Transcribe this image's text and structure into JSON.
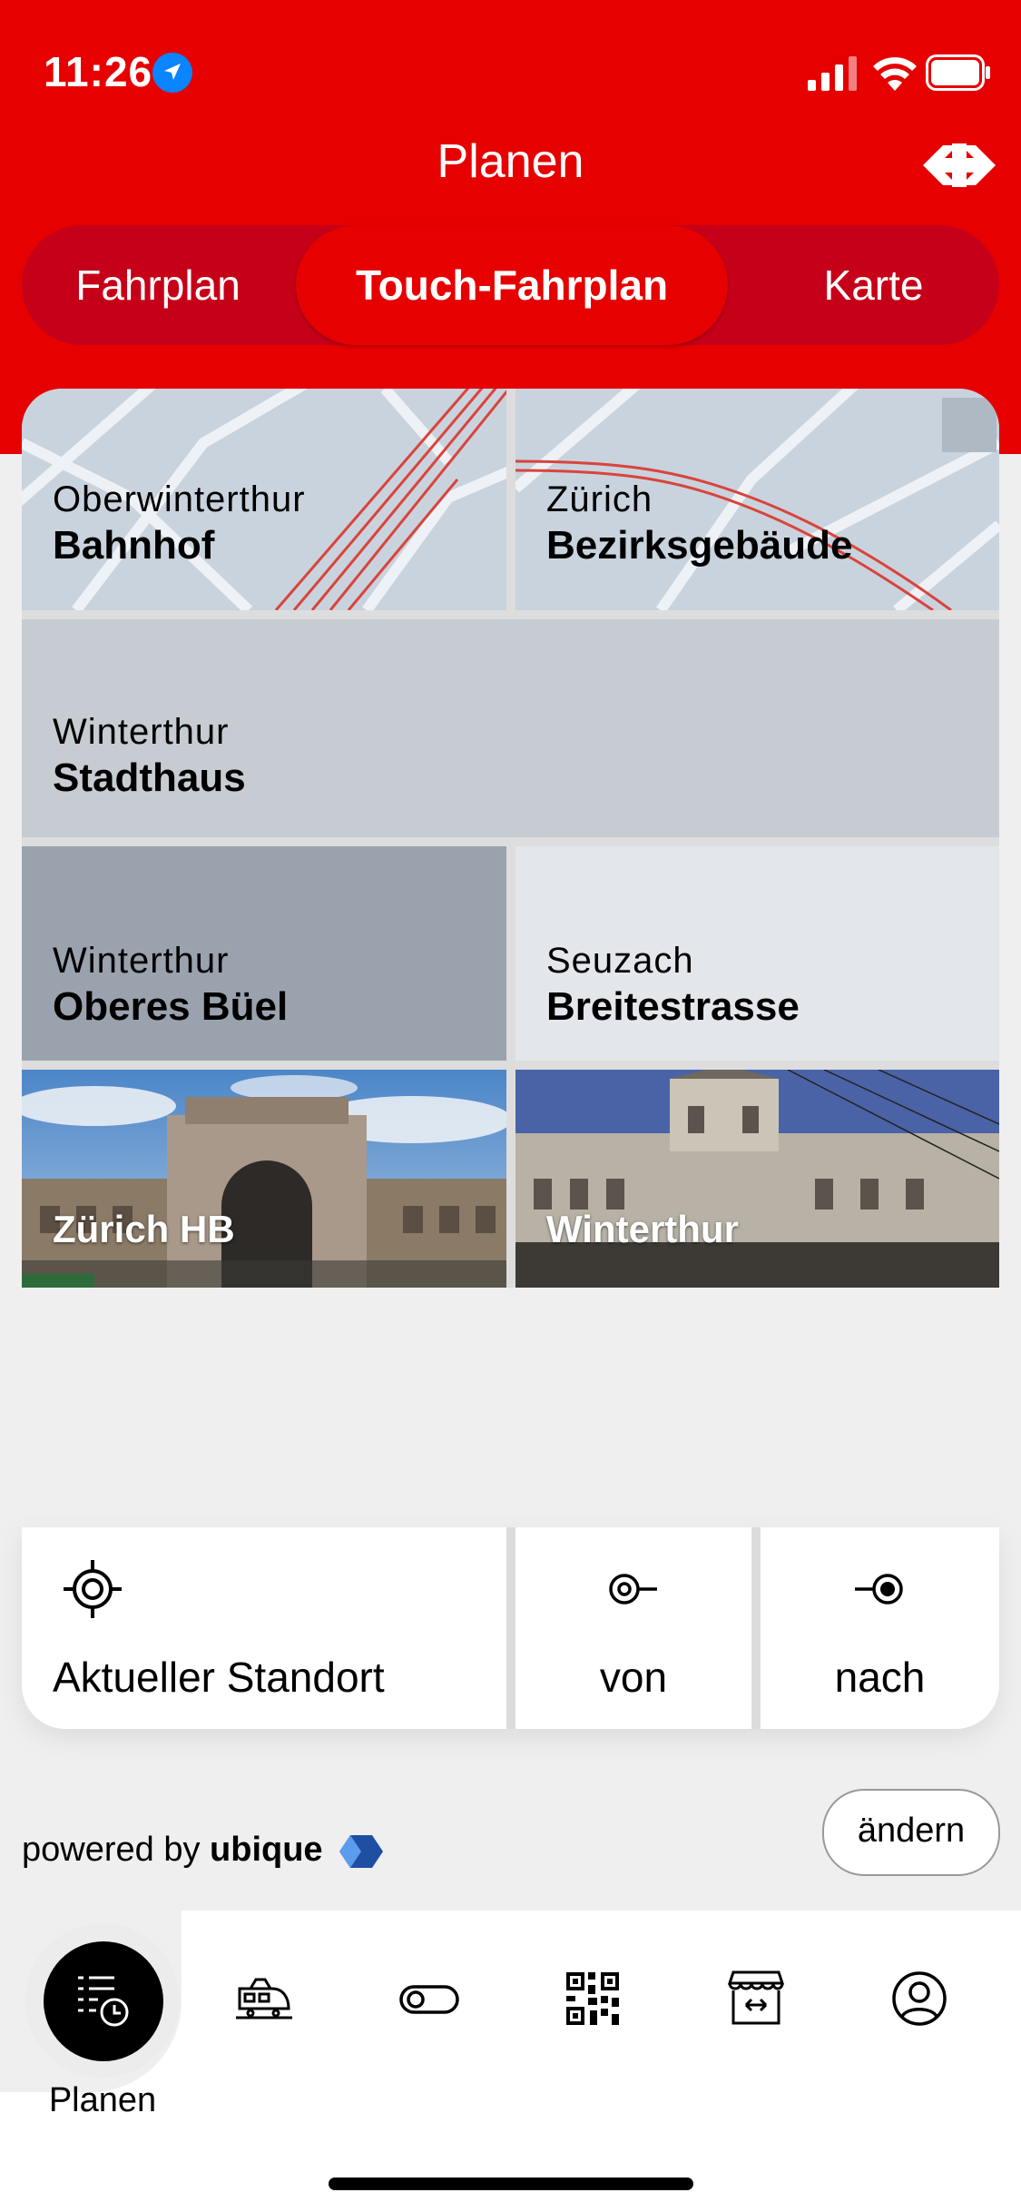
{
  "status_bar": {
    "time": "11:26"
  },
  "header": {
    "title": "Planen"
  },
  "segmented": {
    "tabs": [
      "Fahrplan",
      "Touch-Fahrplan",
      "Karte"
    ]
  },
  "tiles": [
    {
      "line1": "Oberwinterthur",
      "line2": "Bahnhof"
    },
    {
      "line1": "Zürich",
      "line2": "Bezirksgebäude"
    },
    {
      "line1": "Winterthur",
      "line2": "Stadthaus"
    },
    {
      "line1": "Winterthur",
      "line2": "Oberes Büel"
    },
    {
      "line1": "Seuzach",
      "line2": "Breitestrasse"
    },
    {
      "label": "Zürich HB"
    },
    {
      "label": "Winterthur"
    }
  ],
  "actions": {
    "current_location": "Aktueller Standort",
    "from": "von",
    "to": "nach"
  },
  "footer": {
    "powered_prefix": "powered by",
    "powered_brand": "ubique",
    "change_button": "ändern"
  },
  "tabbar": {
    "active_label": "Planen"
  },
  "colors": {
    "brand_red": "#e60000",
    "segment_bg": "#c60018",
    "tile_light": "#c8cdd3",
    "tile_dark": "#99a3ad",
    "tile_pale": "#e2e5e9"
  }
}
